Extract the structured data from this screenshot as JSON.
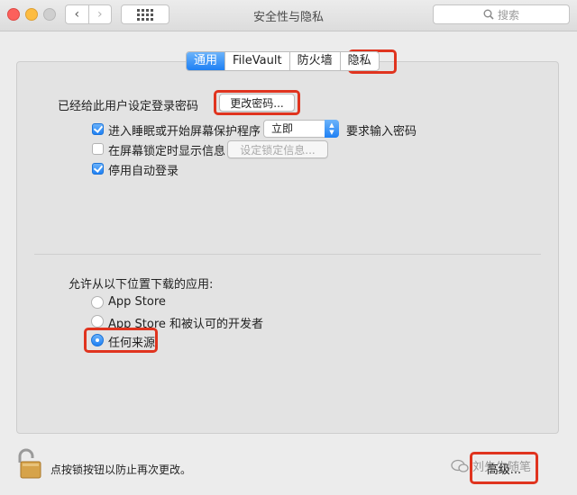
{
  "window": {
    "title": "安全性与隐私",
    "search_placeholder": "搜索",
    "back_icon": "‹",
    "forward_icon": "›"
  },
  "tabs": [
    {
      "label": "通用",
      "active": true
    },
    {
      "label": "FileVault",
      "active": false
    },
    {
      "label": "防火墙",
      "active": false
    },
    {
      "label": "隐私",
      "active": false
    }
  ],
  "general": {
    "password_set_label": "已经给此用户设定登录密码",
    "change_password_button": "更改密码...",
    "sleep_checkbox_label": "进入睡眠或开始屏幕保护程序",
    "sleep_delay_value": "立即",
    "require_password_label": "要求输入密码",
    "show_message_label": "在屏幕锁定时显示信息",
    "set_lock_message_button": "设定锁定信息...",
    "disable_autologin_label": "停用自动登录"
  },
  "downloads": {
    "heading": "允许从以下位置下载的应用:",
    "options": [
      {
        "label": "App Store",
        "selected": false
      },
      {
        "label": "App Store 和被认可的开发者",
        "selected": false
      },
      {
        "label": "任何来源",
        "selected": true
      }
    ]
  },
  "footer": {
    "lock_text": "点按锁按钮以防止再次更改。",
    "advanced_button": "高级...",
    "watermark": "刘先生随笔"
  },
  "colors": {
    "accent": "#1e80f4",
    "highlight": "#e0341f"
  }
}
